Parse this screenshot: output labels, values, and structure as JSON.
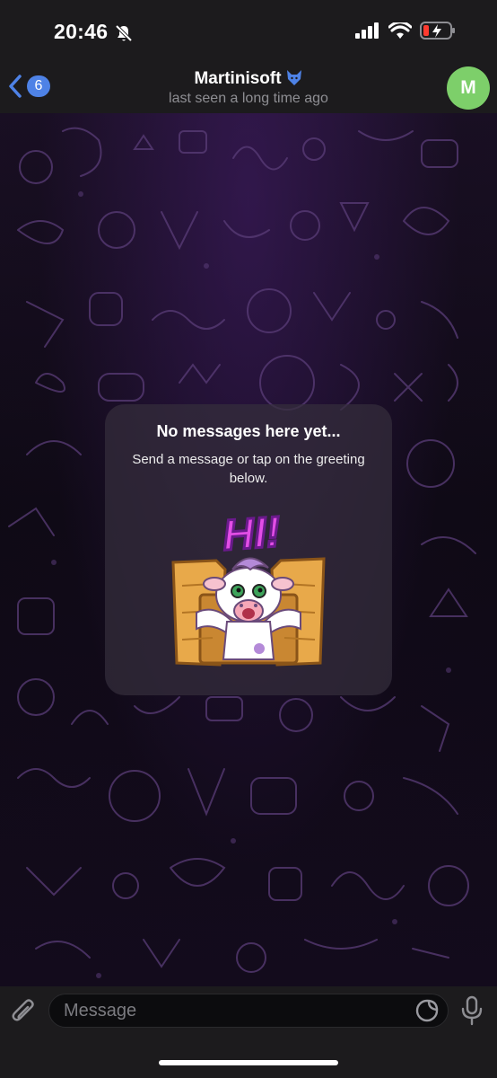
{
  "status_bar": {
    "time": "20:46"
  },
  "header": {
    "back_badge_count": "6",
    "title": "Martinisoft",
    "subtitle": "last seen a long time ago",
    "avatar_initial": "M"
  },
  "empty_state": {
    "title": "No messages here yet...",
    "description": "Send a message or tap on the greeting below.",
    "sticker_text": "HI!"
  },
  "composer": {
    "placeholder": "Message"
  },
  "colors": {
    "accent": "#4e82e6",
    "avatar": "#7dcf6a",
    "background": "#1c1b1d"
  }
}
